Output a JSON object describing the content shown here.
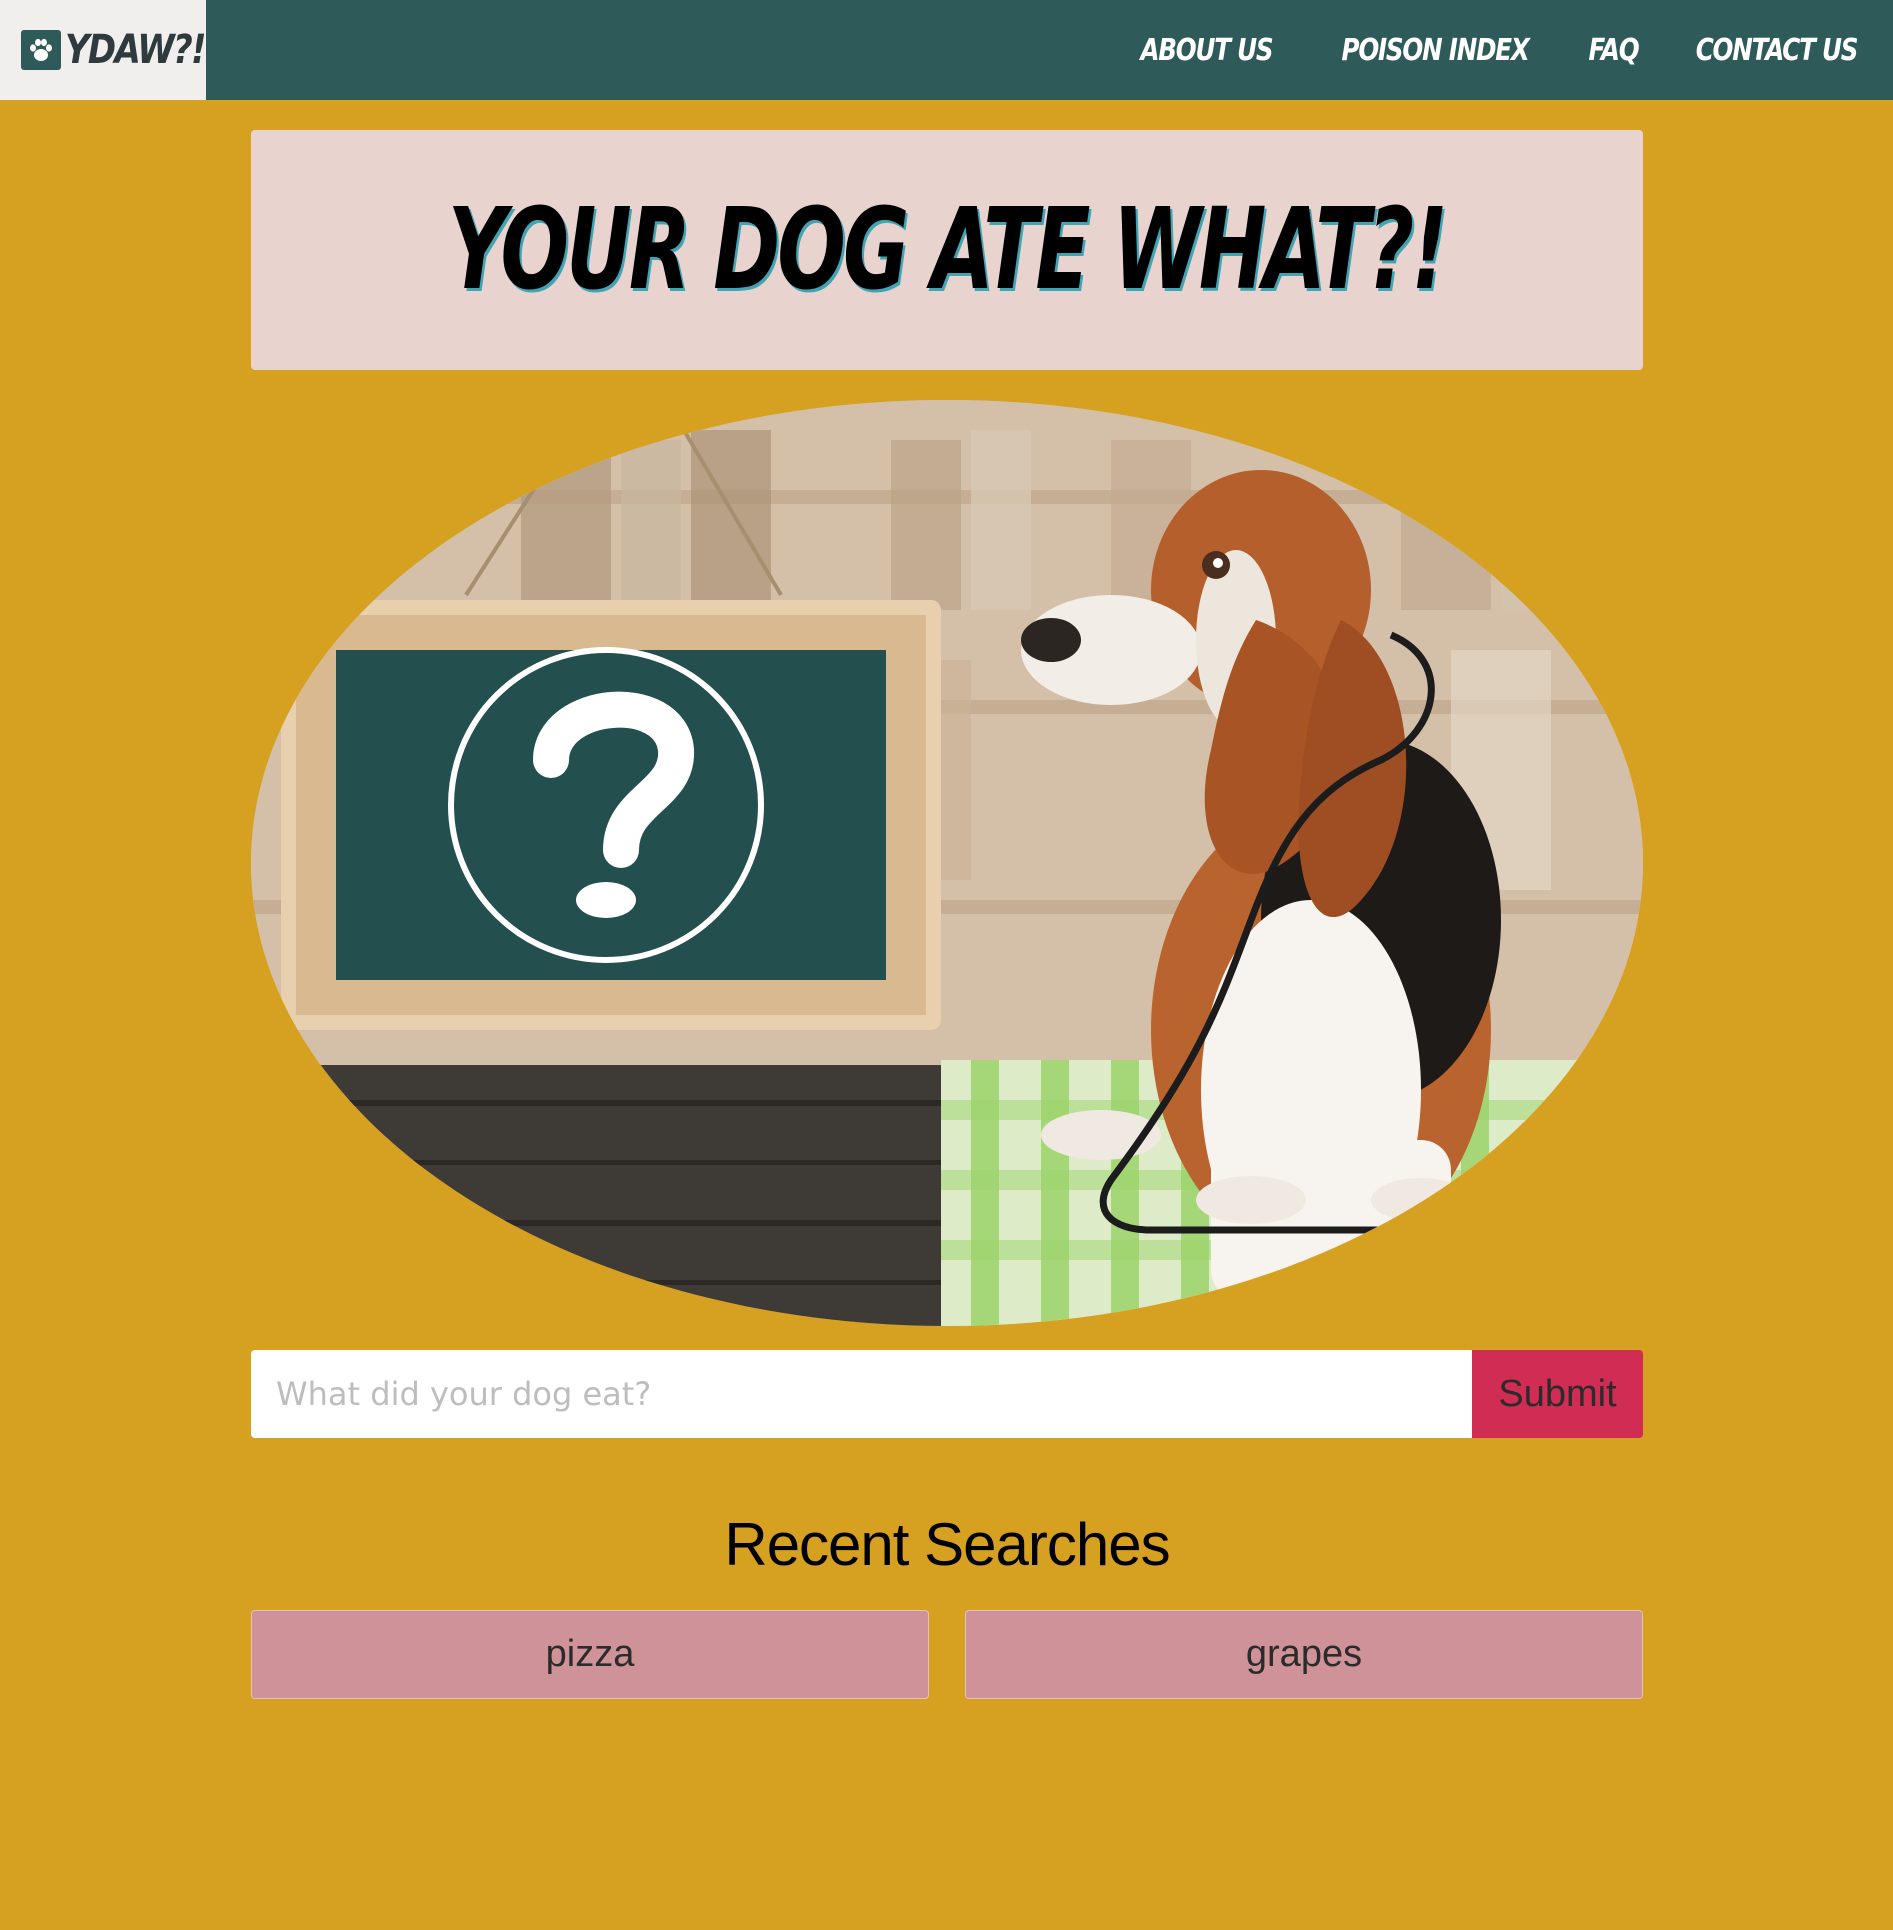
{
  "nav": {
    "brand": "YDAW?!",
    "links": [
      {
        "label": "ABOUT US"
      },
      {
        "label": "POISON INDEX"
      },
      {
        "label": "FAQ"
      },
      {
        "label": "CONTACT US"
      }
    ]
  },
  "hero": {
    "title": "YOUR DOG ATE WHAT?!"
  },
  "search": {
    "placeholder": "What did your dog eat?",
    "value": "",
    "submit_label": "Submit"
  },
  "recent": {
    "title": "Recent Searches",
    "items": [
      {
        "label": "pizza"
      },
      {
        "label": "grapes"
      }
    ]
  },
  "colors": {
    "page_background": "#D6A020",
    "navbar": "#2E5A5A",
    "banner": "#E8D3CE",
    "submit": "#D02C54",
    "recent_item": "#CF9298"
  }
}
